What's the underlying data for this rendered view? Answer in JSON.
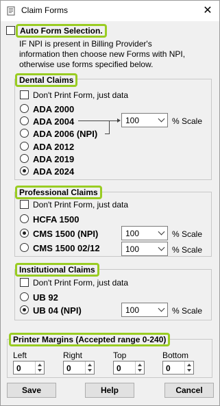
{
  "window": {
    "title": "Claim Forms",
    "close_glyph": "✕"
  },
  "auto_form": {
    "label": "Auto Form Selection.",
    "description_lines": [
      "IF NPI is present in Billing Provider's",
      "information then choose new Forms with NPI,",
      "otherwise use forms specified below."
    ],
    "checked": false
  },
  "dental": {
    "title": "Dental Claims",
    "dont_print": "Don't Print Form, just data",
    "options": [
      "ADA 2000",
      "ADA 2004",
      "ADA 2006 (NPI)",
      "ADA 2012",
      "ADA 2019",
      "ADA 2024"
    ],
    "selected": "ADA 2024",
    "scale_value": "100",
    "scale_label": "% Scale"
  },
  "professional": {
    "title": "Professional Claims",
    "dont_print": "Don't Print Form, just data",
    "options": [
      "HCFA 1500",
      "CMS 1500 (NPI)",
      "CMS 1500 02/12"
    ],
    "selected": "CMS 1500 (NPI)",
    "scales": [
      {
        "value": "100",
        "label": "% Scale"
      },
      {
        "value": "100",
        "label": "% Scale"
      }
    ]
  },
  "institutional": {
    "title": "Institutional Claims",
    "dont_print": "Don't Print Form, just data",
    "options": [
      "UB 92",
      "UB 04 (NPI)"
    ],
    "selected": "UB 04 (NPI)",
    "scale_value": "100",
    "scale_label": "% Scale"
  },
  "margins": {
    "title": "Printer Margins (Accepted range 0-240)",
    "fields": [
      {
        "label": "Left",
        "value": "0"
      },
      {
        "label": "Right",
        "value": "0"
      },
      {
        "label": "Top",
        "value": "0"
      },
      {
        "label": "Bottom",
        "value": "0"
      }
    ]
  },
  "buttons": {
    "save": "Save",
    "help": "Help",
    "cancel": "Cancel"
  },
  "colors": {
    "highlight": "#99cc22",
    "background": "#f0f0f0"
  }
}
